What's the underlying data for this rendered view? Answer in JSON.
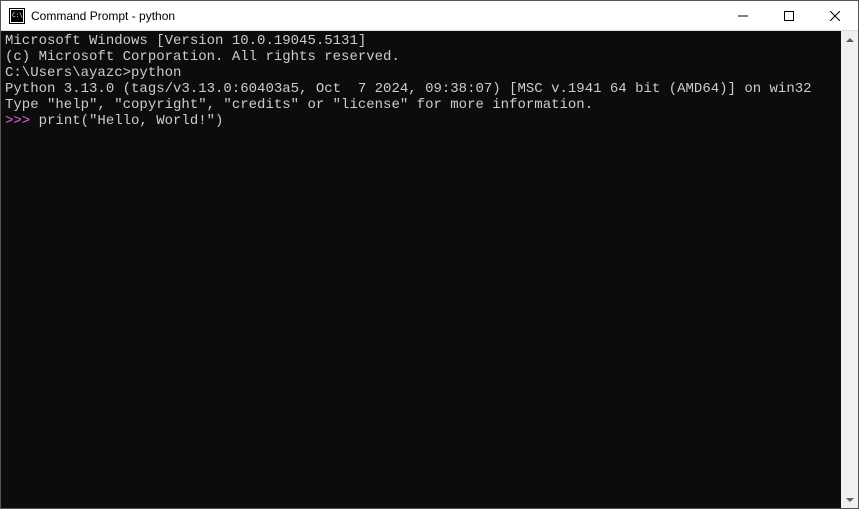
{
  "window": {
    "title": "Command Prompt - python"
  },
  "terminal": {
    "line1": "Microsoft Windows [Version 10.0.19045.5131]",
    "line2": "(c) Microsoft Corporation. All rights reserved.",
    "blank1": "",
    "prompt_path": "C:\\Users\\ayazc>",
    "prompt_cmd": "python",
    "py_version": "Python 3.13.0 (tags/v3.13.0:60403a5, Oct  7 2024, 09:38:07) [MSC v.1941 64 bit (AMD64)] on win32",
    "py_help": "Type \"help\", \"copyright\", \"credits\" or \"license\" for more information.",
    "py_prompt": ">>> ",
    "py_input": "print(\"Hello, World!\")"
  }
}
